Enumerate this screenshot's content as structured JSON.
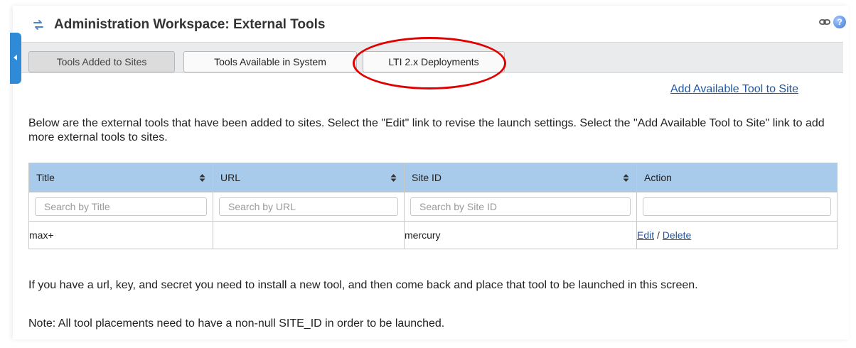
{
  "header": {
    "title": "Administration Workspace: External Tools",
    "help_label": "?"
  },
  "tabs": [
    {
      "label": "Tools Added to Sites",
      "active": true
    },
    {
      "label": "Tools Available in System",
      "active": false
    },
    {
      "label": "LTI 2.x Deployments",
      "active": false
    }
  ],
  "add_link": "Add Available Tool to Site",
  "intro_text": "Below are the external tools that have been added to sites. Select the \"Edit\" link to revise the launch settings. Select the \"Add Available Tool to Site\" link to add more external tools to sites.",
  "table": {
    "columns": [
      "Title",
      "URL",
      "Site ID",
      "Action"
    ],
    "filters": {
      "title_placeholder": "Search by Title",
      "url_placeholder": "Search by URL",
      "site_placeholder": "Search by Site ID"
    },
    "rows": [
      {
        "title": "max+",
        "url": "",
        "site_id": "mercury",
        "edit": "Edit",
        "separator": "/",
        "delete": "Delete"
      }
    ]
  },
  "footer_text_1": "If you have a url, key, and secret you need to install a new tool, and then come back and place that tool to be launched in this screen.",
  "footer_text_2": "Note: All tool placements need to have a non-null SITE_ID in order to be launched.",
  "colors": {
    "accent_blue": "#2f8ad8",
    "header_row": "#a8cbec",
    "link": "#1f57a3",
    "highlight_ellipse": "#e00000"
  },
  "icons": [
    "swap-arrows-icon",
    "link-icon",
    "help-icon",
    "sort-icon",
    "collapse-arrow-icon"
  ]
}
